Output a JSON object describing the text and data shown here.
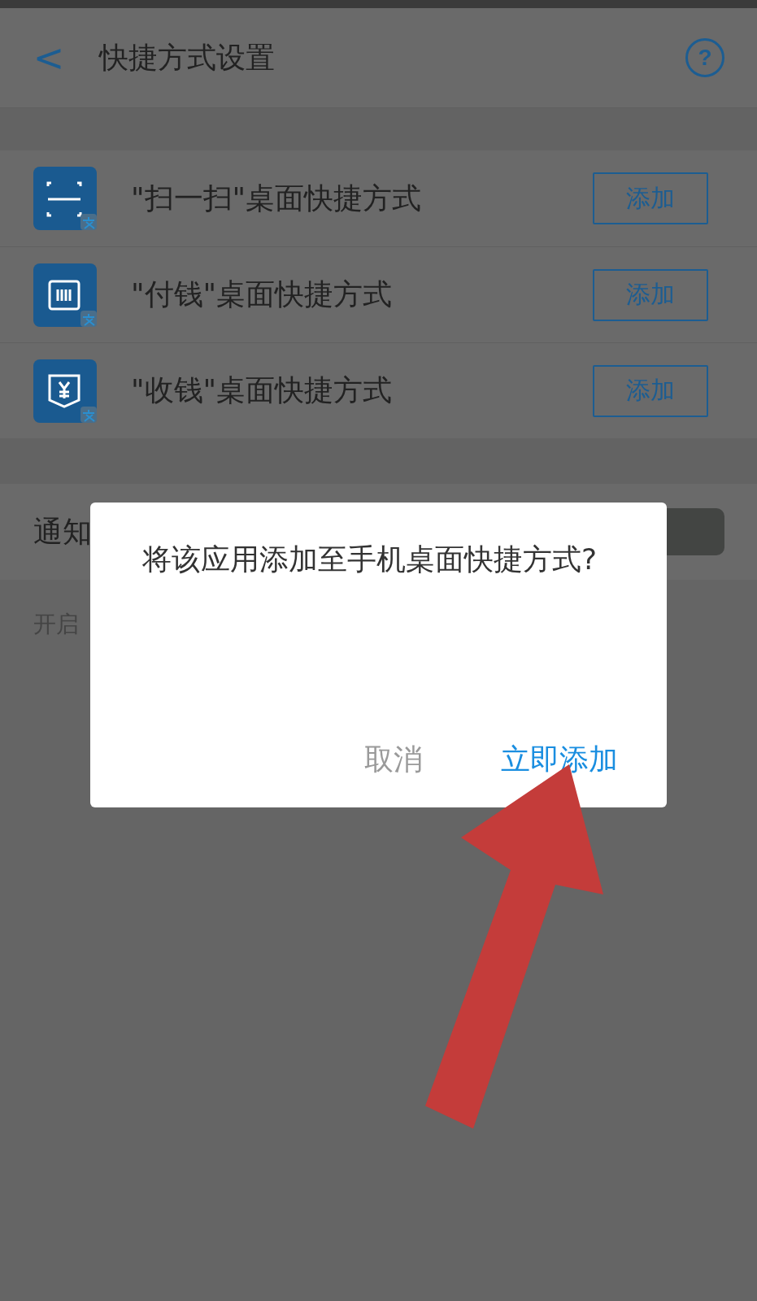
{
  "header": {
    "back": "<",
    "title": "快捷方式设置",
    "help": "?"
  },
  "shortcuts": [
    {
      "kind": "scan",
      "label": "\"扫一扫\"桌面快捷方式",
      "button": "添加"
    },
    {
      "kind": "pay",
      "label": "\"付钱\"桌面快捷方式",
      "button": "添加"
    },
    {
      "kind": "receive",
      "label": "\"收钱\"桌面快捷方式",
      "button": "添加"
    }
  ],
  "notification": {
    "label": "通知",
    "hint": "开启",
    "on": false
  },
  "dialog": {
    "message": "将该应用添加至手机桌面快捷方式?",
    "buttons": [
      {
        "label": "取消",
        "primary": false
      },
      {
        "label": "立即添加",
        "primary": true
      }
    ]
  }
}
